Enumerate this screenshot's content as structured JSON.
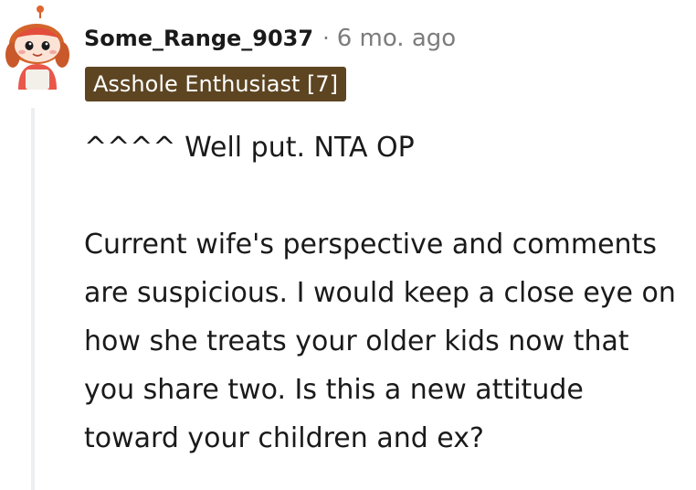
{
  "comment": {
    "username": "Some_Range_9037",
    "separator": "·",
    "timestamp": "6 mo. ago",
    "flair": "Asshole Enthusiast [7]",
    "paragraphs": [
      "^^^^ Well put. NTA OP",
      "Current wife's perspective and comments are suspicious. I would keep a close eye on how she treats your older kids now that you share two. Is this a new attitude toward your children and ex?"
    ],
    "avatar_icon": "snoo-avatar-icon",
    "flair_color": "#5d4522"
  }
}
